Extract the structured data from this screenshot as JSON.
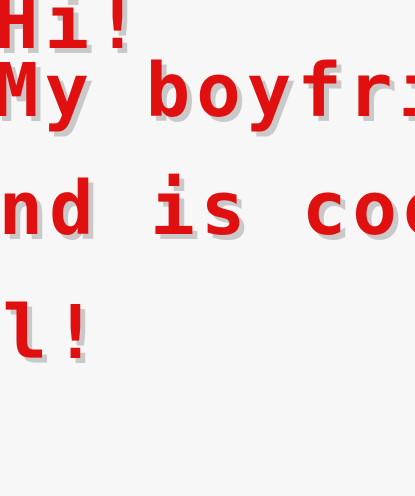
{
  "message": {
    "lines": [
      "Hi!",
      "My boyfrie",
      "end is coo",
      "ol!"
    ],
    "text_color": "#e01010",
    "shadow_color": "#c9c9c9",
    "background_color": "#f7f7f7"
  }
}
